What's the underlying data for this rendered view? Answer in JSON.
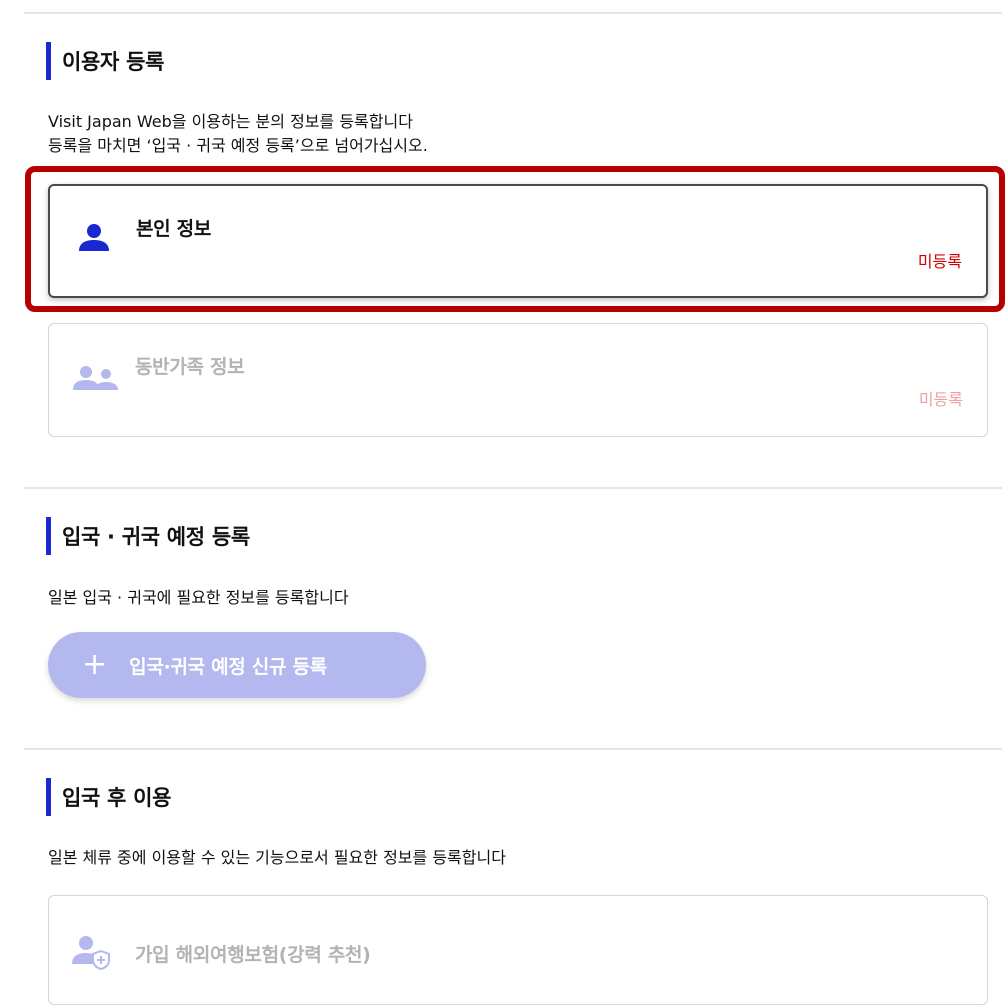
{
  "user_registration": {
    "title": "이용자 등록",
    "description_line1": "Visit Japan Web을 이용하는 분의 정보를 등록합니다",
    "description_line2": "등록을 마치면 ‘입국 · 귀국 예정 등록’으로 넘어가십시오.",
    "cards": [
      {
        "label": "본인 정보",
        "status": "미등록",
        "icon": "person-icon"
      },
      {
        "label": "동반가족 정보",
        "status": "미등록",
        "icon": "people-icon"
      }
    ]
  },
  "entry_return": {
    "title": "입국 · 귀국 예정 등록",
    "description": "일본 입국 · 귀국에 필요한 정보를 등록합니다",
    "add_button_label": "입국·귀국 예정 신규 등록",
    "add_button_icon": "+"
  },
  "after_entry": {
    "title": "입국 후 이용",
    "description": "일본 체류 중에 이용할 수 있는 기능으로서 필요한 정보를 등록합니다",
    "cards": [
      {
        "label": "가입 해외여행보험(강력 추천)",
        "icon": "insurance-person-icon"
      }
    ]
  },
  "colors": {
    "accent_blue": "#1a28d2",
    "status_red": "#d20000",
    "highlight_red": "#b80000",
    "button_disabled": "#b3b8ee"
  }
}
